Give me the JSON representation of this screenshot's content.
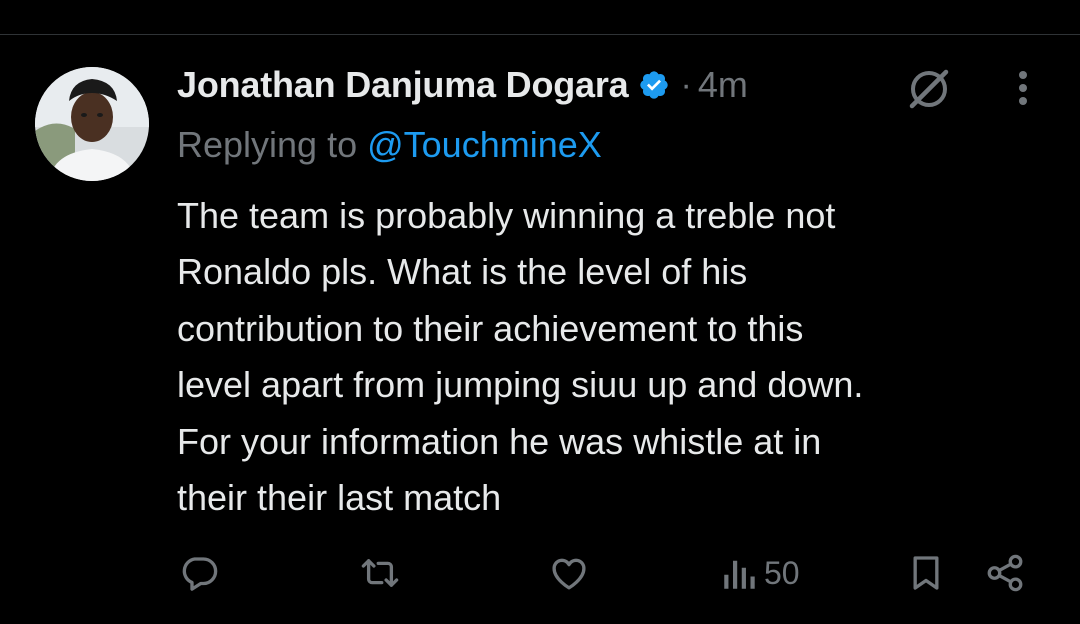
{
  "tweet": {
    "display_name": "Jonathan Danjuma Dogara",
    "verified_icon": "verified-badge-icon",
    "separator": "·",
    "time": "4m",
    "reply_prefix": "Replying to ",
    "reply_handle": "@TouchmineX",
    "text": "The team is probably winning a treble not\nRonaldo pls. What is the level of his\ncontribution to their achievement to this\nlevel apart from jumping siuu up and down.\nFor your information he was whistle at in\ntheir their last match"
  },
  "actions": {
    "views_count": "50",
    "icons": [
      "reply-icon",
      "repost-icon",
      "like-icon",
      "views-icon",
      "bookmark-icon",
      "share-icon"
    ]
  },
  "colors": {
    "background": "#000000",
    "text": "#e7e9ea",
    "muted": "#71767b",
    "accent": "#1d9bf0"
  }
}
